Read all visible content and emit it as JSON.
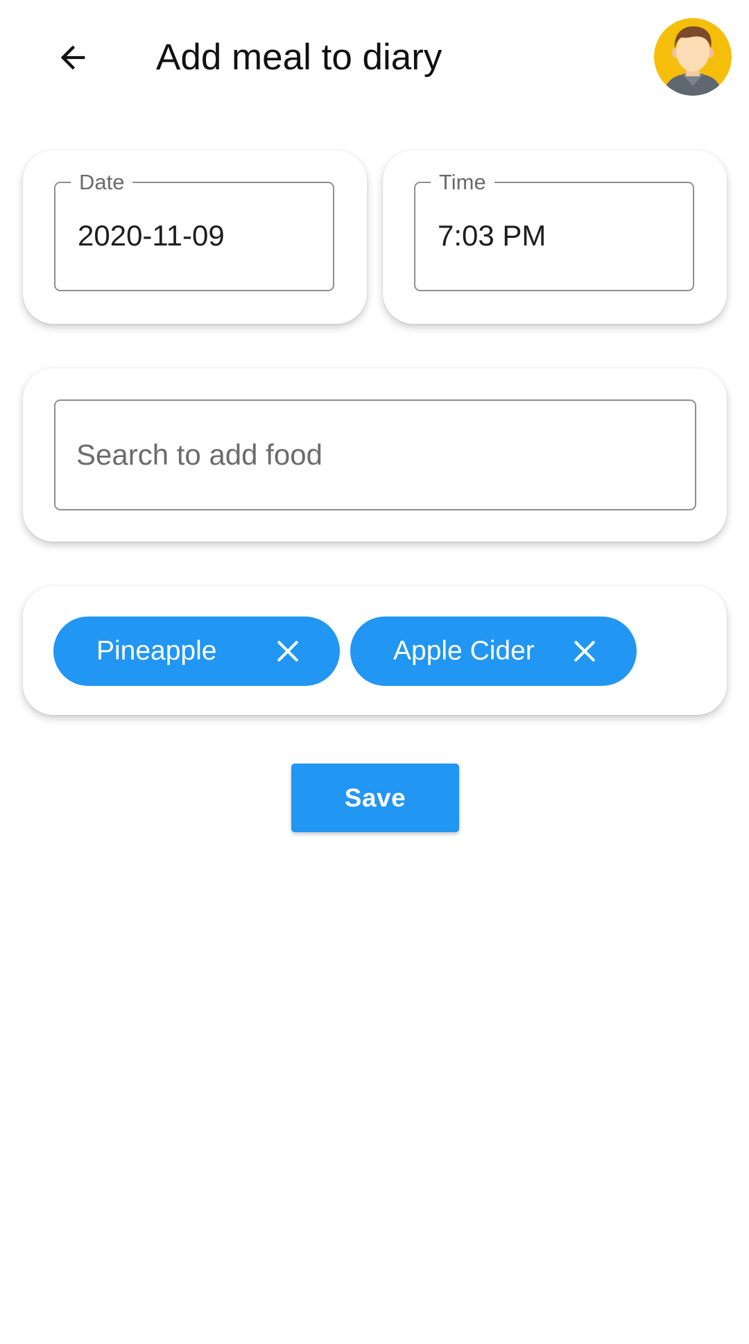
{
  "header": {
    "title": "Add meal to diary",
    "back_icon": "arrow-left-icon",
    "avatar_icon": "user-avatar"
  },
  "date_field": {
    "label": "Date",
    "value": "2020-11-09"
  },
  "time_field": {
    "label": "Time",
    "value": "7:03 PM"
  },
  "search": {
    "placeholder": "Search to add food",
    "value": ""
  },
  "selected_foods": [
    {
      "label": "Pineapple",
      "remove_icon": "close-icon"
    },
    {
      "label": "Apple Cider",
      "remove_icon": "close-icon"
    }
  ],
  "actions": {
    "save_label": "Save"
  },
  "colors": {
    "accent": "#2196f3",
    "avatar_background": "#f5be0b",
    "outline": "#8e8e8e"
  }
}
